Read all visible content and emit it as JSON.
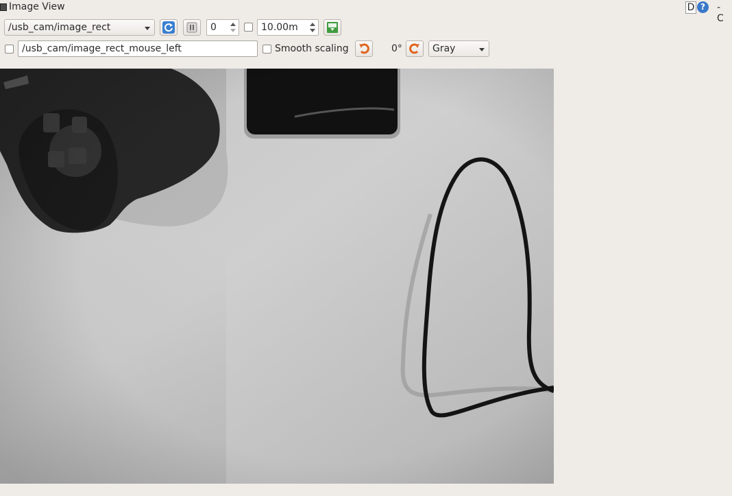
{
  "window": {
    "title": "Image View",
    "d_label": "D",
    "help_label": "?",
    "right_cut_text": "- C"
  },
  "toolbar": {
    "topic": "/usb_cam/image_rect",
    "num_value": "0",
    "duration_value": "10.00m"
  },
  "toolbar2": {
    "mouse_topic": "/usb_cam/image_rect_mouse_left",
    "smooth_label": "Smooth scaling",
    "rotation": "0°",
    "color_scheme": "Gray"
  },
  "icons": {
    "refresh": "refresh-icon",
    "pause": "pause-icon",
    "save": "save-icon",
    "rotate_left": "rotate-left-icon",
    "rotate_right": "rotate-right-icon",
    "app": "window-icon",
    "help": "help-icon"
  },
  "colors": {
    "refresh_blue": "#3a7fd1",
    "rotate_orange": "#e0651e",
    "save_green": "#3f9b3f"
  }
}
